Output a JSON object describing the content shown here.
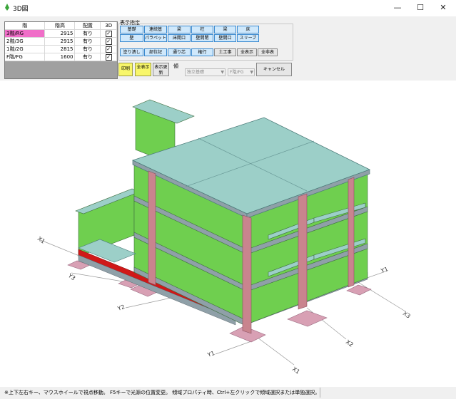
{
  "window": {
    "title": "3D図",
    "minimize": "—",
    "maximize": "☐",
    "close": "✕"
  },
  "floor_table": {
    "headers": {
      "floor": "階",
      "height": "階高",
      "placement": "配置",
      "view3d": "3D"
    },
    "rows": [
      {
        "floor": "3階/RG",
        "height": "2915",
        "placement": "有り",
        "checked": true,
        "selected": true
      },
      {
        "floor": "2階/3G",
        "height": "2915",
        "placement": "有り",
        "checked": true,
        "selected": false
      },
      {
        "floor": "1階/2G",
        "height": "2815",
        "placement": "有り",
        "checked": true,
        "selected": false
      },
      {
        "floor": "F階/FG",
        "height": "1600",
        "placement": "有り",
        "checked": true,
        "selected": false
      }
    ]
  },
  "display_group": {
    "title": "表示指定",
    "row1": [
      "基礎",
      "連続基",
      "梁",
      "柱",
      "梁",
      "床"
    ],
    "row2": [
      "壁",
      "パラペット",
      "床開口",
      "壁開閉",
      "壁開口",
      "スリーブ"
    ]
  },
  "row3_buttons": [
    "塗り潰し",
    "部位記",
    "通り芯",
    "権行",
    "土工事",
    "全表示",
    "全非表"
  ],
  "actions": {
    "print": "印刷",
    "show_all": "全表示",
    "refresh": "表示更新",
    "direction": "傾",
    "cancel": "キャンセル"
  },
  "combos": {
    "element_type": "独立基礎",
    "floor": "F階/FG"
  },
  "axis_labels": {
    "x1_left": "X1",
    "y3_left": "Y3",
    "y2_front": "Y2",
    "y1_front": "Y1",
    "x1_front": "X1",
    "x2_front": "X2",
    "x3_right": "X3",
    "y1_right": "Y1"
  },
  "colors": {
    "slab": "#9ccfc8",
    "wall_green": "#6fcf4f",
    "column": "#c9848e",
    "footing": "#d8a0b4",
    "beam_gray": "#8fa0a8",
    "ground_beam_red": "#d01818",
    "floor_row_highlight": "#f06ec8",
    "button_blue": "#cfe8fb",
    "button_yellow": "#f8f66a"
  },
  "status": {
    "help": "※上下左右キー、マウスホイールで視点移動。 F5キーで光源の位置変更。 傾域プロパティ時、Ctrl+左クリックで傾域選択または単独選択。"
  }
}
